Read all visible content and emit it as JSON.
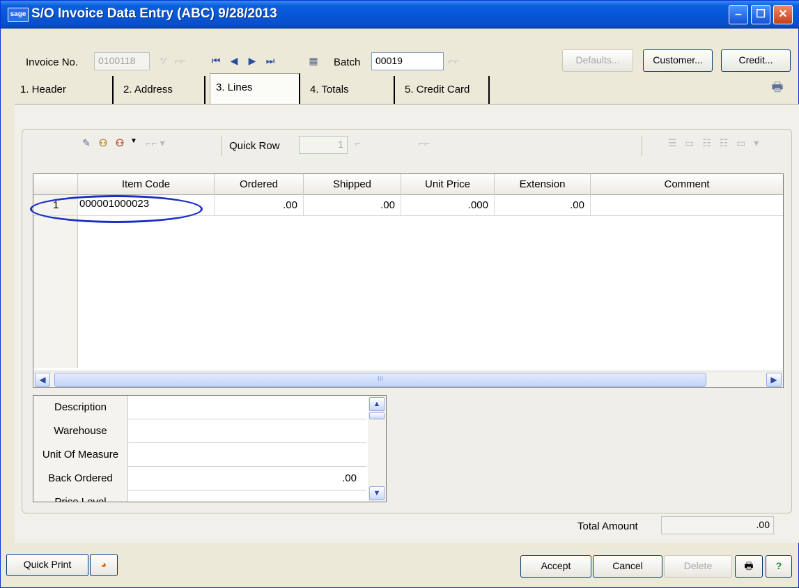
{
  "window": {
    "logo": "sage",
    "title": "S/O Invoice Data Entry (ABC) 9/28/2013",
    "minimize_glyph": "‒",
    "maximize_glyph": "☐",
    "close_glyph": "✕"
  },
  "header_row": {
    "invoice_label": "Invoice No.",
    "invoice_value": "0100118",
    "batch_label": "Batch",
    "batch_value": "00019",
    "defaults_label": "Defaults...",
    "customer_label": "Customer...",
    "credit_label": "Credit..."
  },
  "tabs": [
    {
      "label": "1. Header"
    },
    {
      "label": "2. Address"
    },
    {
      "label": "3. Lines"
    },
    {
      "label": "4. Totals"
    },
    {
      "label": "5. Credit Card"
    }
  ],
  "toolbar": {
    "quick_row_label": "Quick Row",
    "quick_row_value": "1"
  },
  "grid": {
    "columns": [
      "Item Code",
      "Ordered",
      "Shipped",
      "Unit Price",
      "Extension",
      "Comment"
    ],
    "rows": [
      {
        "row_no": "1",
        "item_code": "000001000023",
        "ordered": ".00",
        "shipped": ".00",
        "unit_price": ".000",
        "extension": ".00",
        "comment": ""
      }
    ],
    "scroll_grip": "III"
  },
  "properties": [
    {
      "label": "Description",
      "value": ""
    },
    {
      "label": "Warehouse",
      "value": ""
    },
    {
      "label": "Unit Of Measure",
      "value": ""
    },
    {
      "label": "Back Ordered",
      "value": ".00"
    },
    {
      "label": "Price Level",
      "value": ""
    }
  ],
  "totals": {
    "total_amount_label": "Total Amount",
    "total_amount_value": ".00"
  },
  "footer": {
    "quick_print_label": "Quick Print",
    "accept_label": "Accept",
    "cancel_label": "Cancel",
    "delete_label": "Delete"
  },
  "colors": {
    "title_bar": "#0655d4",
    "window_bg": "#ece9d8",
    "highlight_circle": "#1b2fc7"
  }
}
